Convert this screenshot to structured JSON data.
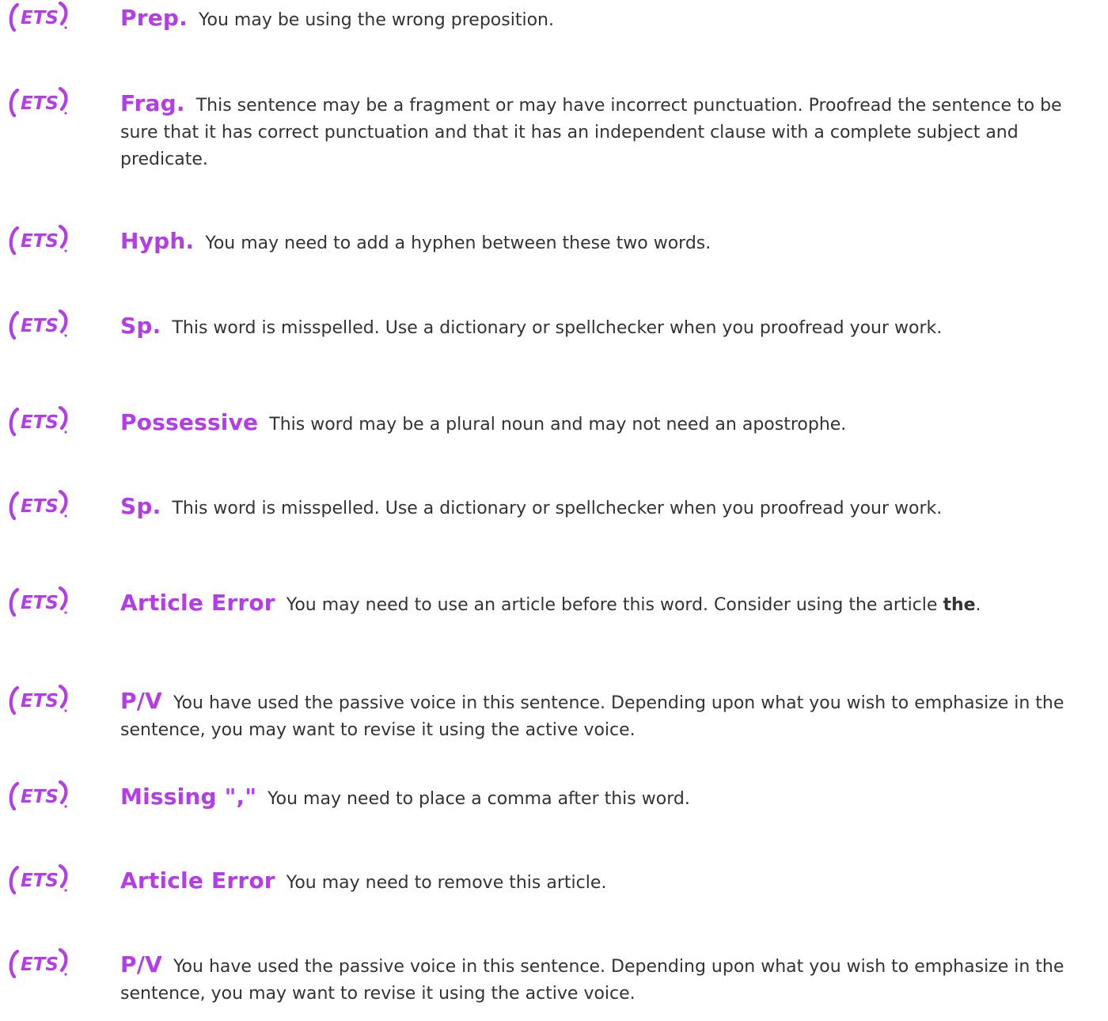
{
  "brand": {
    "logo_text": "ETS",
    "logo_color": "#b43de8",
    "category_color": "#b43de8",
    "text_color": "#333333"
  },
  "feedback": [
    {
      "category": "Prep.",
      "message": "You may be using the wrong preposition."
    },
    {
      "category": "Frag.",
      "message": "This sentence may be a fragment or may have incorrect punctuation. Proofread the sentence to be sure that it has correct punctuation and that it has an independent clause with a complete subject and predicate."
    },
    {
      "category": "Hyph.",
      "message": "You may need to add a hyphen between these two words."
    },
    {
      "category": "Sp.",
      "message": "This word is misspelled. Use a dictionary or spellchecker when you proofread your work."
    },
    {
      "category": "Possessive",
      "message": "This word may be a plural noun and may not need an apostrophe."
    },
    {
      "category": "Sp.",
      "message": "This word is misspelled. Use a dictionary or spellchecker when you proofread your work."
    },
    {
      "category": "Article Error",
      "message": "You may need to use an article before this word. Consider using the article",
      "bold": "the",
      "tail": "."
    },
    {
      "category": "P/V",
      "message": "You have used the passive voice in this sentence. Depending upon what you wish to emphasize in the sentence, you may want to revise it using the active voice."
    },
    {
      "category": "Missing \",\"",
      "message": "You may need to place a comma after this word."
    },
    {
      "category": "Article Error",
      "message": "You may need to remove this article."
    },
    {
      "category": "P/V",
      "message": "You have used the passive voice in this sentence. Depending upon what you wish to emphasize in the sentence, you may want to revise it using the active voice."
    }
  ]
}
